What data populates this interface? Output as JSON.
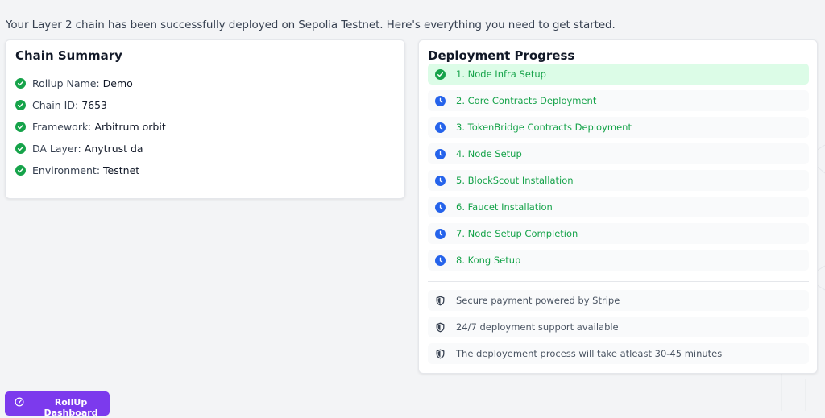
{
  "intro": "Your Layer 2 chain has been successfully deployed on Sepolia Testnet. Here's everything you need to get started.",
  "summary": {
    "title": "Chain Summary",
    "items": [
      {
        "label": "Rollup Name:",
        "value": "Demo"
      },
      {
        "label": "Chain ID:",
        "value": "7653"
      },
      {
        "label": "Framework:",
        "value": "Arbitrum orbit"
      },
      {
        "label": "DA Layer:",
        "value": "Anytrust da"
      },
      {
        "label": "Environment:",
        "value": "Testnet"
      }
    ]
  },
  "progress": {
    "title": "Deployment Progress",
    "steps": [
      {
        "label": "1. Node Infra Setup",
        "status": "done"
      },
      {
        "label": "2. Core Contracts Deployment",
        "status": "pending"
      },
      {
        "label": "3. TokenBridge Contracts Deployment",
        "status": "pending"
      },
      {
        "label": "4. Node Setup",
        "status": "pending"
      },
      {
        "label": "5. BlockScout Installation",
        "status": "pending"
      },
      {
        "label": "6. Faucet Installation",
        "status": "pending"
      },
      {
        "label": "7. Node Setup Completion",
        "status": "pending"
      },
      {
        "label": "8. Kong Setup",
        "status": "pending"
      }
    ],
    "notes": [
      {
        "label": "Secure payment powered by Stripe",
        "icon": "shield-icon"
      },
      {
        "label": "24/7 deployment support available",
        "icon": "shield-icon"
      },
      {
        "label": "The deployement process will take atleast 30-45 minutes",
        "icon": "shield-icon"
      }
    ]
  },
  "dashboard_button": {
    "label": "RollUp Dashboard",
    "icon": "gauge-icon"
  },
  "colors": {
    "success": "#16a34a",
    "pending": "#2563eb",
    "primary": "#7c3aed",
    "done_row_bg": "#dcfce7"
  }
}
